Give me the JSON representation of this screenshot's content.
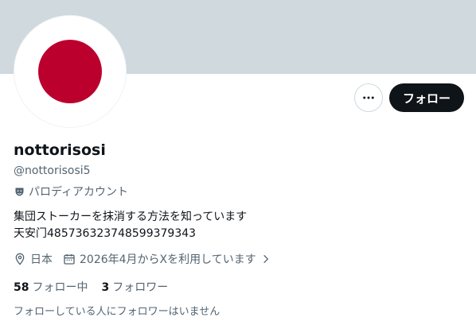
{
  "profile": {
    "display_name": "nottorisosi",
    "handle": "@nottorisosi5",
    "parody_label": "パロディアカウント",
    "bio_line1": "集団ストーカーを抹消する方法を知っています",
    "bio_line2": "天安门485736323748599379343",
    "location": "日本",
    "joined": "2026年4月からXを利用しています",
    "following_count": "58",
    "following_label": "フォロー中",
    "followers_count": "3",
    "followers_label": "フォロワー",
    "followers_note": "フォローしている人にフォロワーはいません"
  },
  "actions": {
    "follow_label": "フォロー",
    "more_icon": "more-horizontal-icon"
  },
  "avatar": {
    "description_icon": "japan-flag-avatar",
    "sun_color": "#bc002d"
  },
  "colors": {
    "banner": "#cfd9de",
    "primary_text": "#0f1419",
    "secondary_text": "#536471",
    "follow_button_bg": "#0f1419"
  }
}
